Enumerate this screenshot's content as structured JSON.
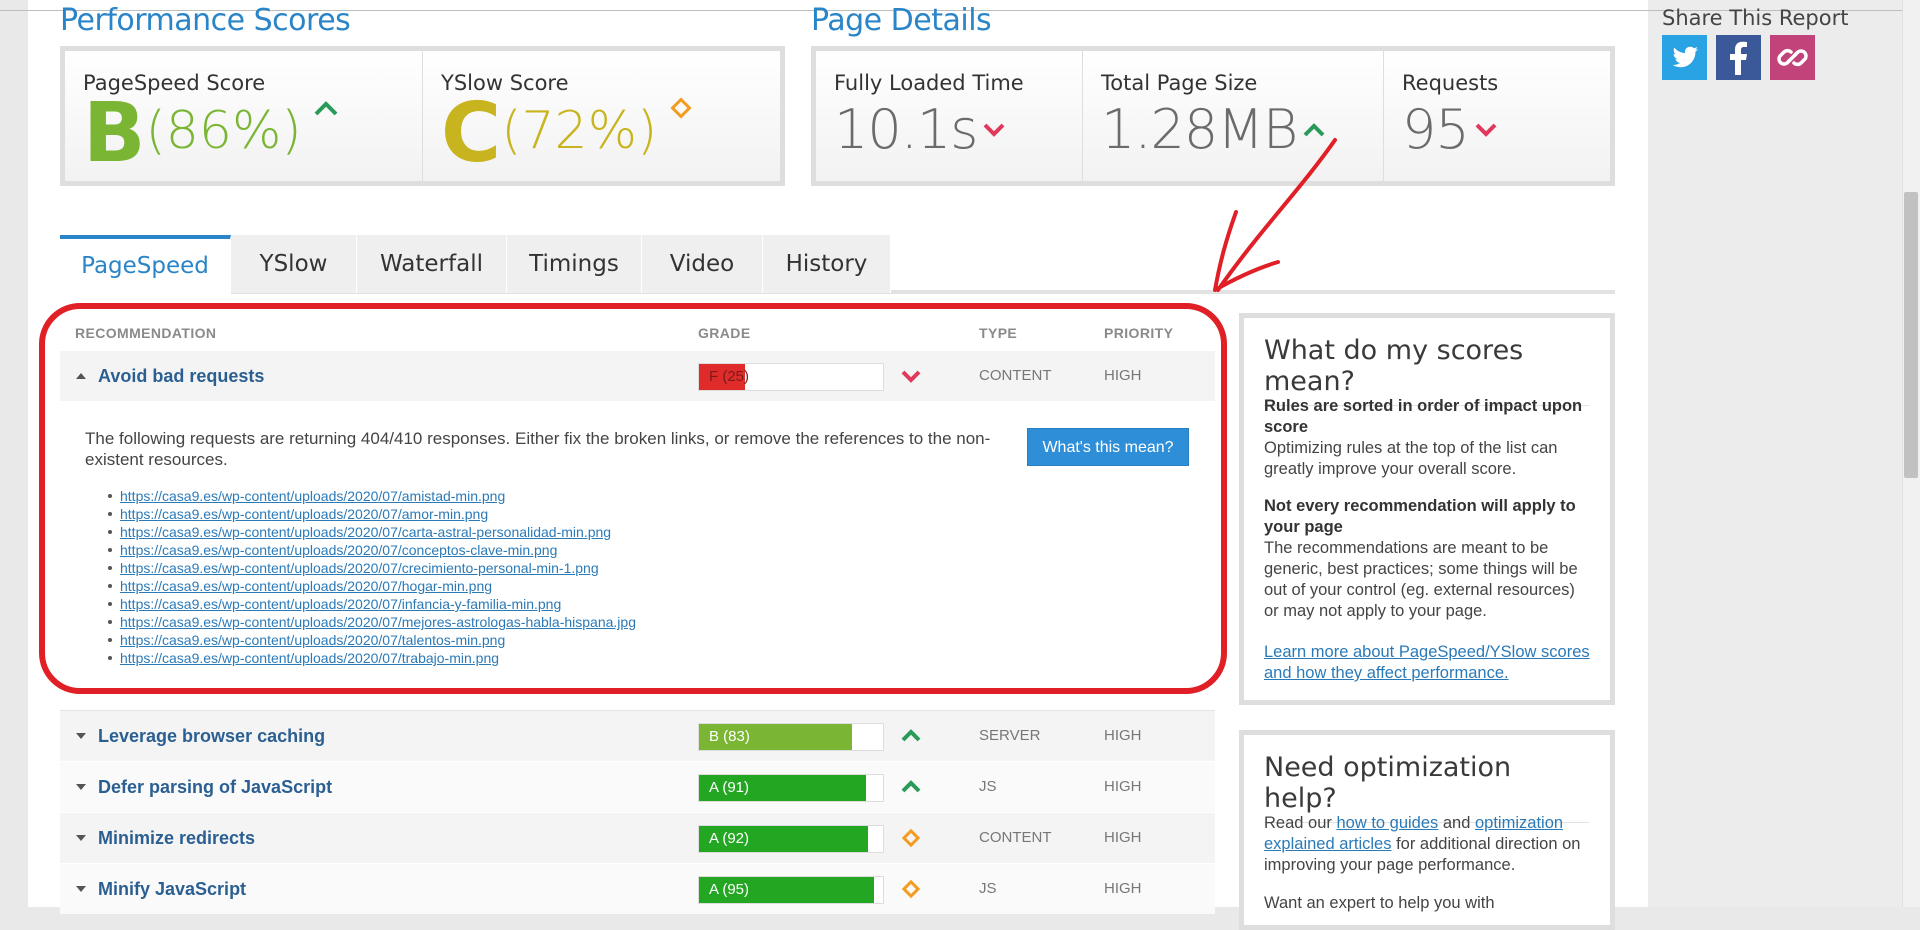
{
  "colors": {
    "accent": "#2a85c8",
    "grade_b": "#7ab634",
    "grade_c": "#c8b41e",
    "grade_a": "#23a722",
    "grade_f": "#e02b2b",
    "up": "#2a9a58",
    "down": "#e0395a",
    "neutral": "#f39c22",
    "annotation": "#e01f26"
  },
  "performance": {
    "title": "Performance Scores",
    "pagespeed": {
      "label": "PageSpeed Score",
      "grade": "B",
      "percent": "(86%)",
      "trend": "up"
    },
    "yslow": {
      "label": "YSlow Score",
      "grade": "C",
      "percent": "(72%)",
      "trend": "neutral"
    }
  },
  "details": {
    "title": "Page Details",
    "loaded": {
      "label": "Fully Loaded Time",
      "value": "10.1s",
      "trend": "down"
    },
    "size": {
      "label": "Total Page Size",
      "value": "1.28MB",
      "trend": "up"
    },
    "requests": {
      "label": "Requests",
      "value": "95",
      "trend": "down"
    }
  },
  "share": {
    "title": "Share This Report",
    "buttons": [
      {
        "name": "twitter-icon",
        "color": "#2aa3e5"
      },
      {
        "name": "facebook-icon",
        "color": "#3b5998"
      },
      {
        "name": "link-icon",
        "color": "#c2437a"
      }
    ]
  },
  "tabs": [
    "PageSpeed",
    "YSlow",
    "Waterfall",
    "Timings",
    "Video",
    "History"
  ],
  "table": {
    "headers": {
      "recommendation": "RECOMMENDATION",
      "grade": "GRADE",
      "type": "TYPE",
      "priority": "PRIORITY"
    },
    "expanded": {
      "title": "Avoid bad requests",
      "grade_text": "F (25)",
      "score": 25,
      "type": "CONTENT",
      "priority": "HIGH",
      "trend": "down",
      "description": "The following requests are returning 404/410 responses. Either fix the broken links, or remove the references to the non-existent resources.",
      "button": "What's this mean?",
      "urls": [
        "https://casa9.es/wp-content/uploads/2020/07/amistad-min.png",
        "https://casa9.es/wp-content/uploads/2020/07/amor-min.png",
        "https://casa9.es/wp-content/uploads/2020/07/carta-astral-personalidad-min.png",
        "https://casa9.es/wp-content/uploads/2020/07/conceptos-clave-min.png",
        "https://casa9.es/wp-content/uploads/2020/07/crecimiento-personal-min-1.png",
        "https://casa9.es/wp-content/uploads/2020/07/hogar-min.png",
        "https://casa9.es/wp-content/uploads/2020/07/infancia-y-familia-min.png",
        "https://casa9.es/wp-content/uploads/2020/07/mejores-astrologas-habla-hispana.jpg",
        "https://casa9.es/wp-content/uploads/2020/07/talentos-min.png",
        "https://casa9.es/wp-content/uploads/2020/07/trabajo-min.png"
      ]
    },
    "rows": [
      {
        "title": "Leverage browser caching",
        "grade_text": "B (83)",
        "score": 83,
        "type": "SERVER",
        "priority": "HIGH",
        "trend": "up"
      },
      {
        "title": "Defer parsing of JavaScript",
        "grade_text": "A (91)",
        "score": 91,
        "type": "JS",
        "priority": "HIGH",
        "trend": "up"
      },
      {
        "title": "Minimize redirects",
        "grade_text": "A (92)",
        "score": 92,
        "type": "CONTENT",
        "priority": "HIGH",
        "trend": "neutral"
      },
      {
        "title": "Minify JavaScript",
        "grade_text": "A (95)",
        "score": 95,
        "type": "JS",
        "priority": "HIGH",
        "trend": "neutral"
      }
    ]
  },
  "sidebar": {
    "scores_box": {
      "title": "What do my scores mean?",
      "h1": "Rules are sorted in order of impact upon score",
      "p1": "Optimizing rules at the top of the list can greatly improve your overall score.",
      "h2": "Not every recommendation will apply to your page",
      "p2": "The recommendations are meant to be generic, best practices; some things will be out of your control (eg. external resources) or may not apply to your page.",
      "link": "Learn more about PageSpeed/YSlow scores and how they affect performance."
    },
    "help_box": {
      "title": "Need optimization help?",
      "read_our": "Read our ",
      "link1": "how to guides",
      "and": " and ",
      "link2": "optimization explained articles",
      "rest": " for additional direction on improving your page performance.",
      "expert": "Want an expert to help you with"
    }
  }
}
